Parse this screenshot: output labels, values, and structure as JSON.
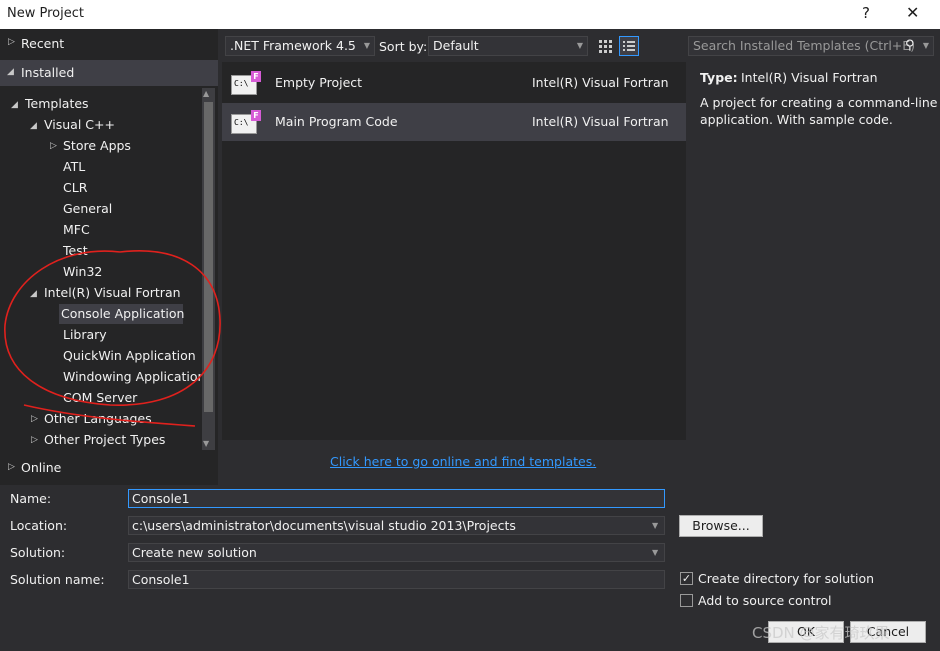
{
  "window": {
    "title": "New Project",
    "help_glyph": "?",
    "close_glyph": "✕"
  },
  "left": {
    "categories": [
      {
        "label": "Recent"
      },
      {
        "label": "Installed"
      },
      {
        "label": "Online"
      }
    ],
    "tree": [
      {
        "label": "Templates"
      },
      {
        "label": "Visual C++"
      },
      {
        "label": "Store Apps"
      },
      {
        "label": "ATL"
      },
      {
        "label": "CLR"
      },
      {
        "label": "General"
      },
      {
        "label": "MFC"
      },
      {
        "label": "Test"
      },
      {
        "label": "Win32"
      },
      {
        "label": "Intel(R) Visual Fortran"
      },
      {
        "label": "Console Application"
      },
      {
        "label": "Library"
      },
      {
        "label": "QuickWin Application"
      },
      {
        "label": "Windowing Application"
      },
      {
        "label": "COM Server"
      },
      {
        "label": "Other Languages"
      },
      {
        "label": "Other Project Types"
      }
    ]
  },
  "toolbar": {
    "framework": ".NET Framework 4.5",
    "sort_label": "Sort by:",
    "sort_value": "Default",
    "search_placeholder": "Search Installed Templates (Ctrl+E)"
  },
  "templates": [
    {
      "name": "Empty Project",
      "type": "Intel(R) Visual Fortran",
      "icon_text": "C:\\",
      "badge": "F"
    },
    {
      "name": "Main Program Code",
      "type": "Intel(R) Visual Fortran",
      "icon_text": "C:\\",
      "badge": "F"
    }
  ],
  "details": {
    "type_label": "Type:",
    "type_value": "Intel(R) Visual Fortran",
    "description_line1": "A project for creating a command-line",
    "description_line2": "application. With sample code."
  },
  "online_link": "Click here to go online and find templates.",
  "form": {
    "name_label": "Name:",
    "name_value": "Console1",
    "location_label": "Location:",
    "location_value": "c:\\users\\administrator\\documents\\visual studio 2013\\Projects",
    "browse_label": "Browse...",
    "solution_label": "Solution:",
    "solution_value": "Create new solution",
    "solution_name_label": "Solution name:",
    "solution_name_value": "Console1",
    "create_dir_label": "Create directory for solution",
    "source_control_label": "Add to source control",
    "ok_label": "OK",
    "cancel_label": "Cancel"
  },
  "watermark": "CSDN @家有琦玖果",
  "colors": {
    "accent": "#3399ff",
    "background": "#2d2d30",
    "selection": "#3f3f46",
    "annotation": "#e0211d"
  }
}
